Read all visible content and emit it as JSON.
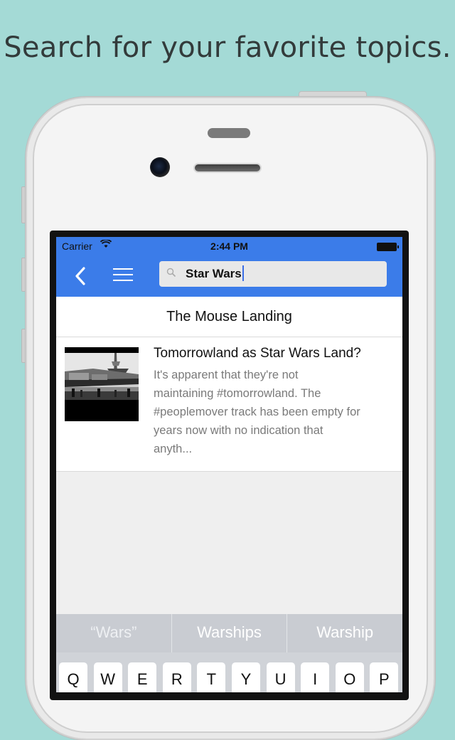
{
  "headline": "Search for your favorite topics.",
  "status_bar": {
    "carrier": "Carrier",
    "time": "2:44 PM",
    "wifi_icon": "wifi-icon",
    "battery_icon": "battery-icon"
  },
  "nav": {
    "back_icon": "back-chevron-icon",
    "menu_icon": "hamburger-menu-icon",
    "search_value": "Star Wars"
  },
  "section": {
    "title": "The Mouse Landing"
  },
  "results": [
    {
      "title": "Tomorrowland as Star Wars Land?",
      "excerpt_lines": [
        "It's apparent that they're not",
        "maintaining #tomorrowland. The",
        "#peoplemover track has been empty for",
        "years now with no indication that",
        "anyth..."
      ]
    }
  ],
  "keyboard": {
    "suggestions": [
      "“Wars”",
      "Warships",
      "Warship"
    ],
    "top_row": [
      "Q",
      "W",
      "E",
      "R",
      "T",
      "Y",
      "U",
      "I",
      "O",
      "P"
    ]
  },
  "colors": {
    "accent": "#3b7ce9",
    "background": "#a4dad6"
  }
}
